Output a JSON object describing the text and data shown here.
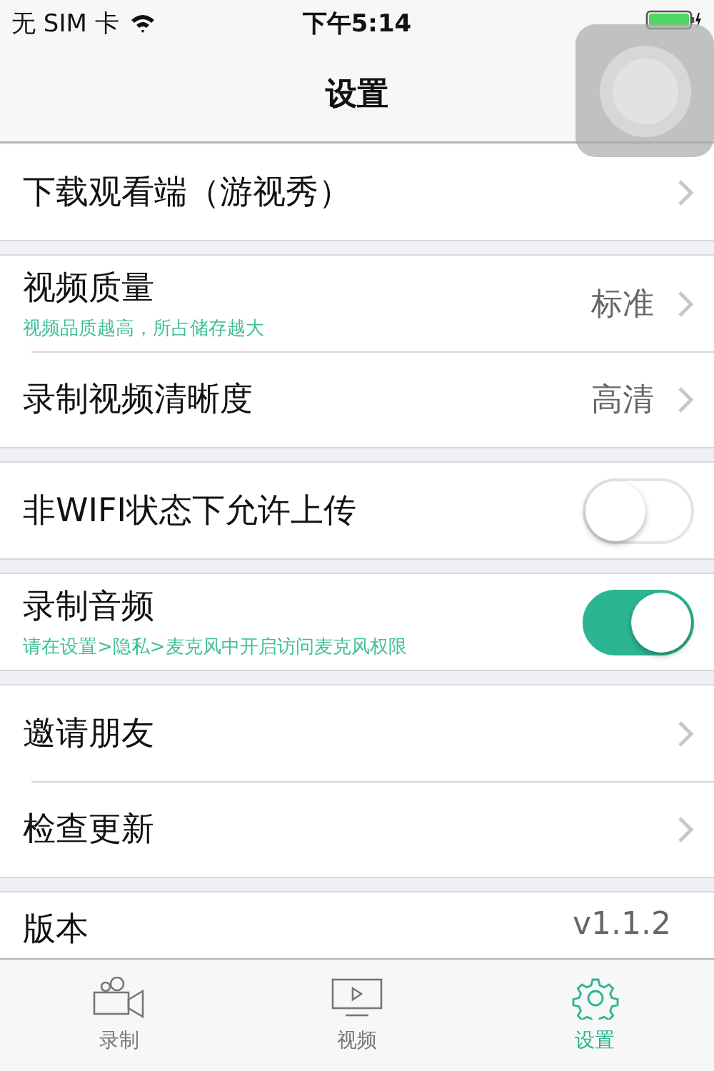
{
  "status_bar": {
    "carrier": "无 SIM 卡",
    "time": "下午5:14"
  },
  "nav": {
    "title": "设置"
  },
  "sections": [
    {
      "rows": [
        {
          "kind": "link",
          "label": "下载观看端（游视秀）"
        }
      ]
    },
    {
      "rows": [
        {
          "kind": "link",
          "label": "视频质量",
          "subtitle": "视频品质越高，所占储存越大",
          "value": "标准"
        },
        {
          "kind": "link",
          "label": "录制视频清晰度",
          "value": "高清"
        }
      ]
    },
    {
      "rows": [
        {
          "kind": "toggle",
          "label": "非WIFI状态下允许上传",
          "on": false
        }
      ]
    },
    {
      "rows": [
        {
          "kind": "toggle",
          "label": "录制音频",
          "subtitle": "请在设置>隐私>麦克风中开启访问麦克风权限",
          "on": true
        }
      ]
    },
    {
      "rows": [
        {
          "kind": "link",
          "label": "邀请朋友"
        },
        {
          "kind": "link",
          "label": "检查更新"
        }
      ]
    },
    {
      "rows": [
        {
          "kind": "info",
          "label": "版本",
          "value": "v1.1.2"
        }
      ]
    }
  ],
  "tab_bar": [
    {
      "kind": "camera",
      "label": "录制",
      "selected": false
    },
    {
      "kind": "video",
      "label": "视频",
      "selected": false
    },
    {
      "kind": "settings",
      "label": "设置",
      "selected": true
    }
  ]
}
